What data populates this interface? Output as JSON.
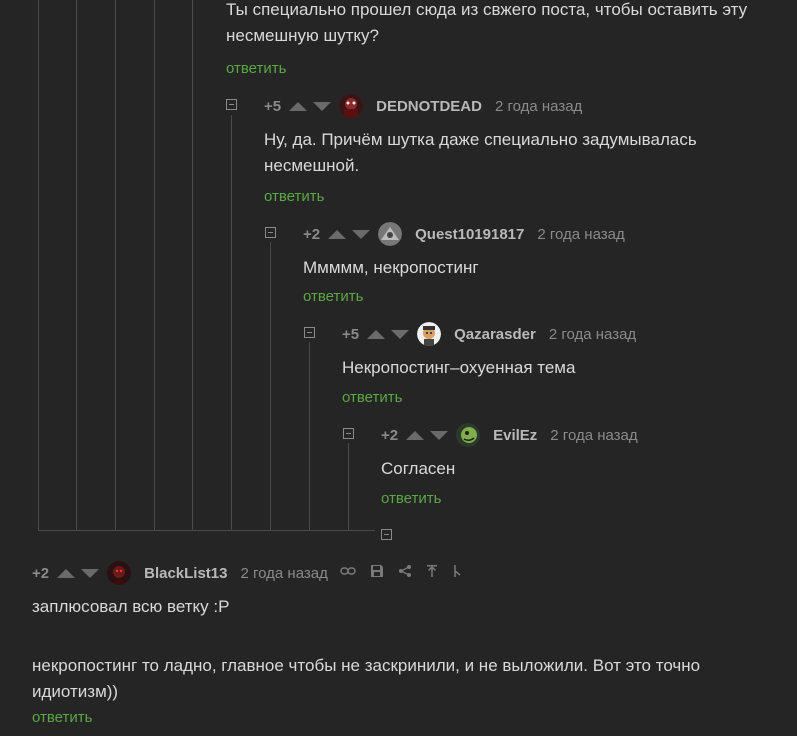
{
  "thread": {
    "comments": [
      {
        "text_line1": "Ты специально прошел сюда из свжего поста, чтобы оставить эту",
        "text_line2": "несмешную шутку?",
        "reply_label": "ответить"
      },
      {
        "rating": "+5",
        "author": "DEDNOTDEAD",
        "time": "2 года назад",
        "text_line1": "Ну, да. Причём шутка даже специально задумывалась",
        "text_line2": "несмешной.",
        "reply_label": "ответить"
      },
      {
        "rating": "+2",
        "author": "Quest10191817",
        "time": "2 года назад",
        "text_line1": "Ммммм, некропостинг",
        "reply_label": "ответить"
      },
      {
        "rating": "+5",
        "author": "Qazarasder",
        "time": "2 года назад",
        "text_line1": "Некропостинг–охуенная тема",
        "reply_label": "ответить"
      },
      {
        "rating": "+2",
        "author": "EvilEz",
        "time": "2 года назад",
        "text_line1": "Согласен",
        "reply_label": "ответить"
      }
    ],
    "root_comment": {
      "rating": "+2",
      "author": "BlackList13",
      "time": "2 года назад",
      "text_line1": "заплюсовал всю ветку :P",
      "text_line2": "некропостинг то ладно, главное чтобы не заскринили, и не выложили. Вот это точно",
      "text_line3": "идиотизм))",
      "reply_label": "ответить",
      "tools": [
        "link-icon",
        "save-icon",
        "share-icon",
        "go-to-parent-icon",
        "go-to-branch-icon"
      ]
    }
  },
  "colors": {
    "background": "#252525",
    "text": "#d9d9d9",
    "muted": "#8a8a8a",
    "reply_link": "#5aa843",
    "thread_line": "#4a4a4a"
  }
}
